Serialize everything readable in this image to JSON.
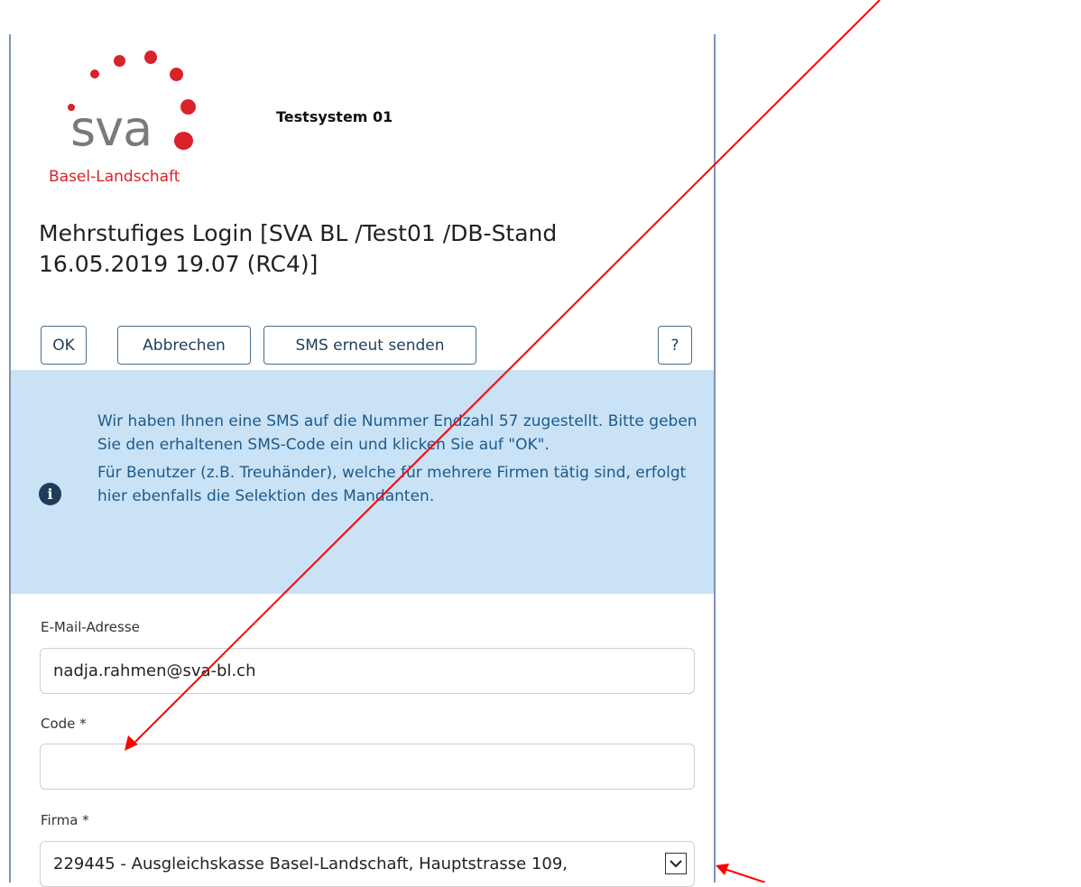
{
  "logo": {
    "text": "sva",
    "subtitle": "Basel-Landschaft"
  },
  "header": {
    "system_name": "Testsystem 01"
  },
  "page": {
    "title": "Mehrstufiges Login [SVA BL /Test01 /DB-Stand 16.05.2019 19.07 (RC4)]"
  },
  "toolbar": {
    "ok_label": "OK",
    "cancel_label": "Abbrechen",
    "resend_label": "SMS erneut senden",
    "help_label": "?"
  },
  "info": {
    "paragraph1": "Wir haben Ihnen eine SMS auf die Nummer Endzahl 57 zugestellt. Bitte geben Sie den erhaltenen SMS-Code ein und klicken Sie auf \"OK\".",
    "paragraph2": "Für Benutzer (z.B. Treuhänder), welche für mehrere Firmen tätig sind, erfolgt hier ebenfalls die Selektion des Mandanten."
  },
  "form": {
    "email_label": "E-Mail-Adresse",
    "email_value": "nadja.rahmen@sva-bl.ch",
    "code_label": "Code *",
    "code_value": "",
    "firma_label": "Firma *",
    "firma_value": "229445 - Ausgleichskasse Basel-Landschaft, Hauptstrasse 109,"
  },
  "colors": {
    "brand_red": "#d9222a",
    "info_bg": "#c9e2f6",
    "info_text": "#1e5a8a",
    "annotation_arrow": "#ff0000"
  }
}
